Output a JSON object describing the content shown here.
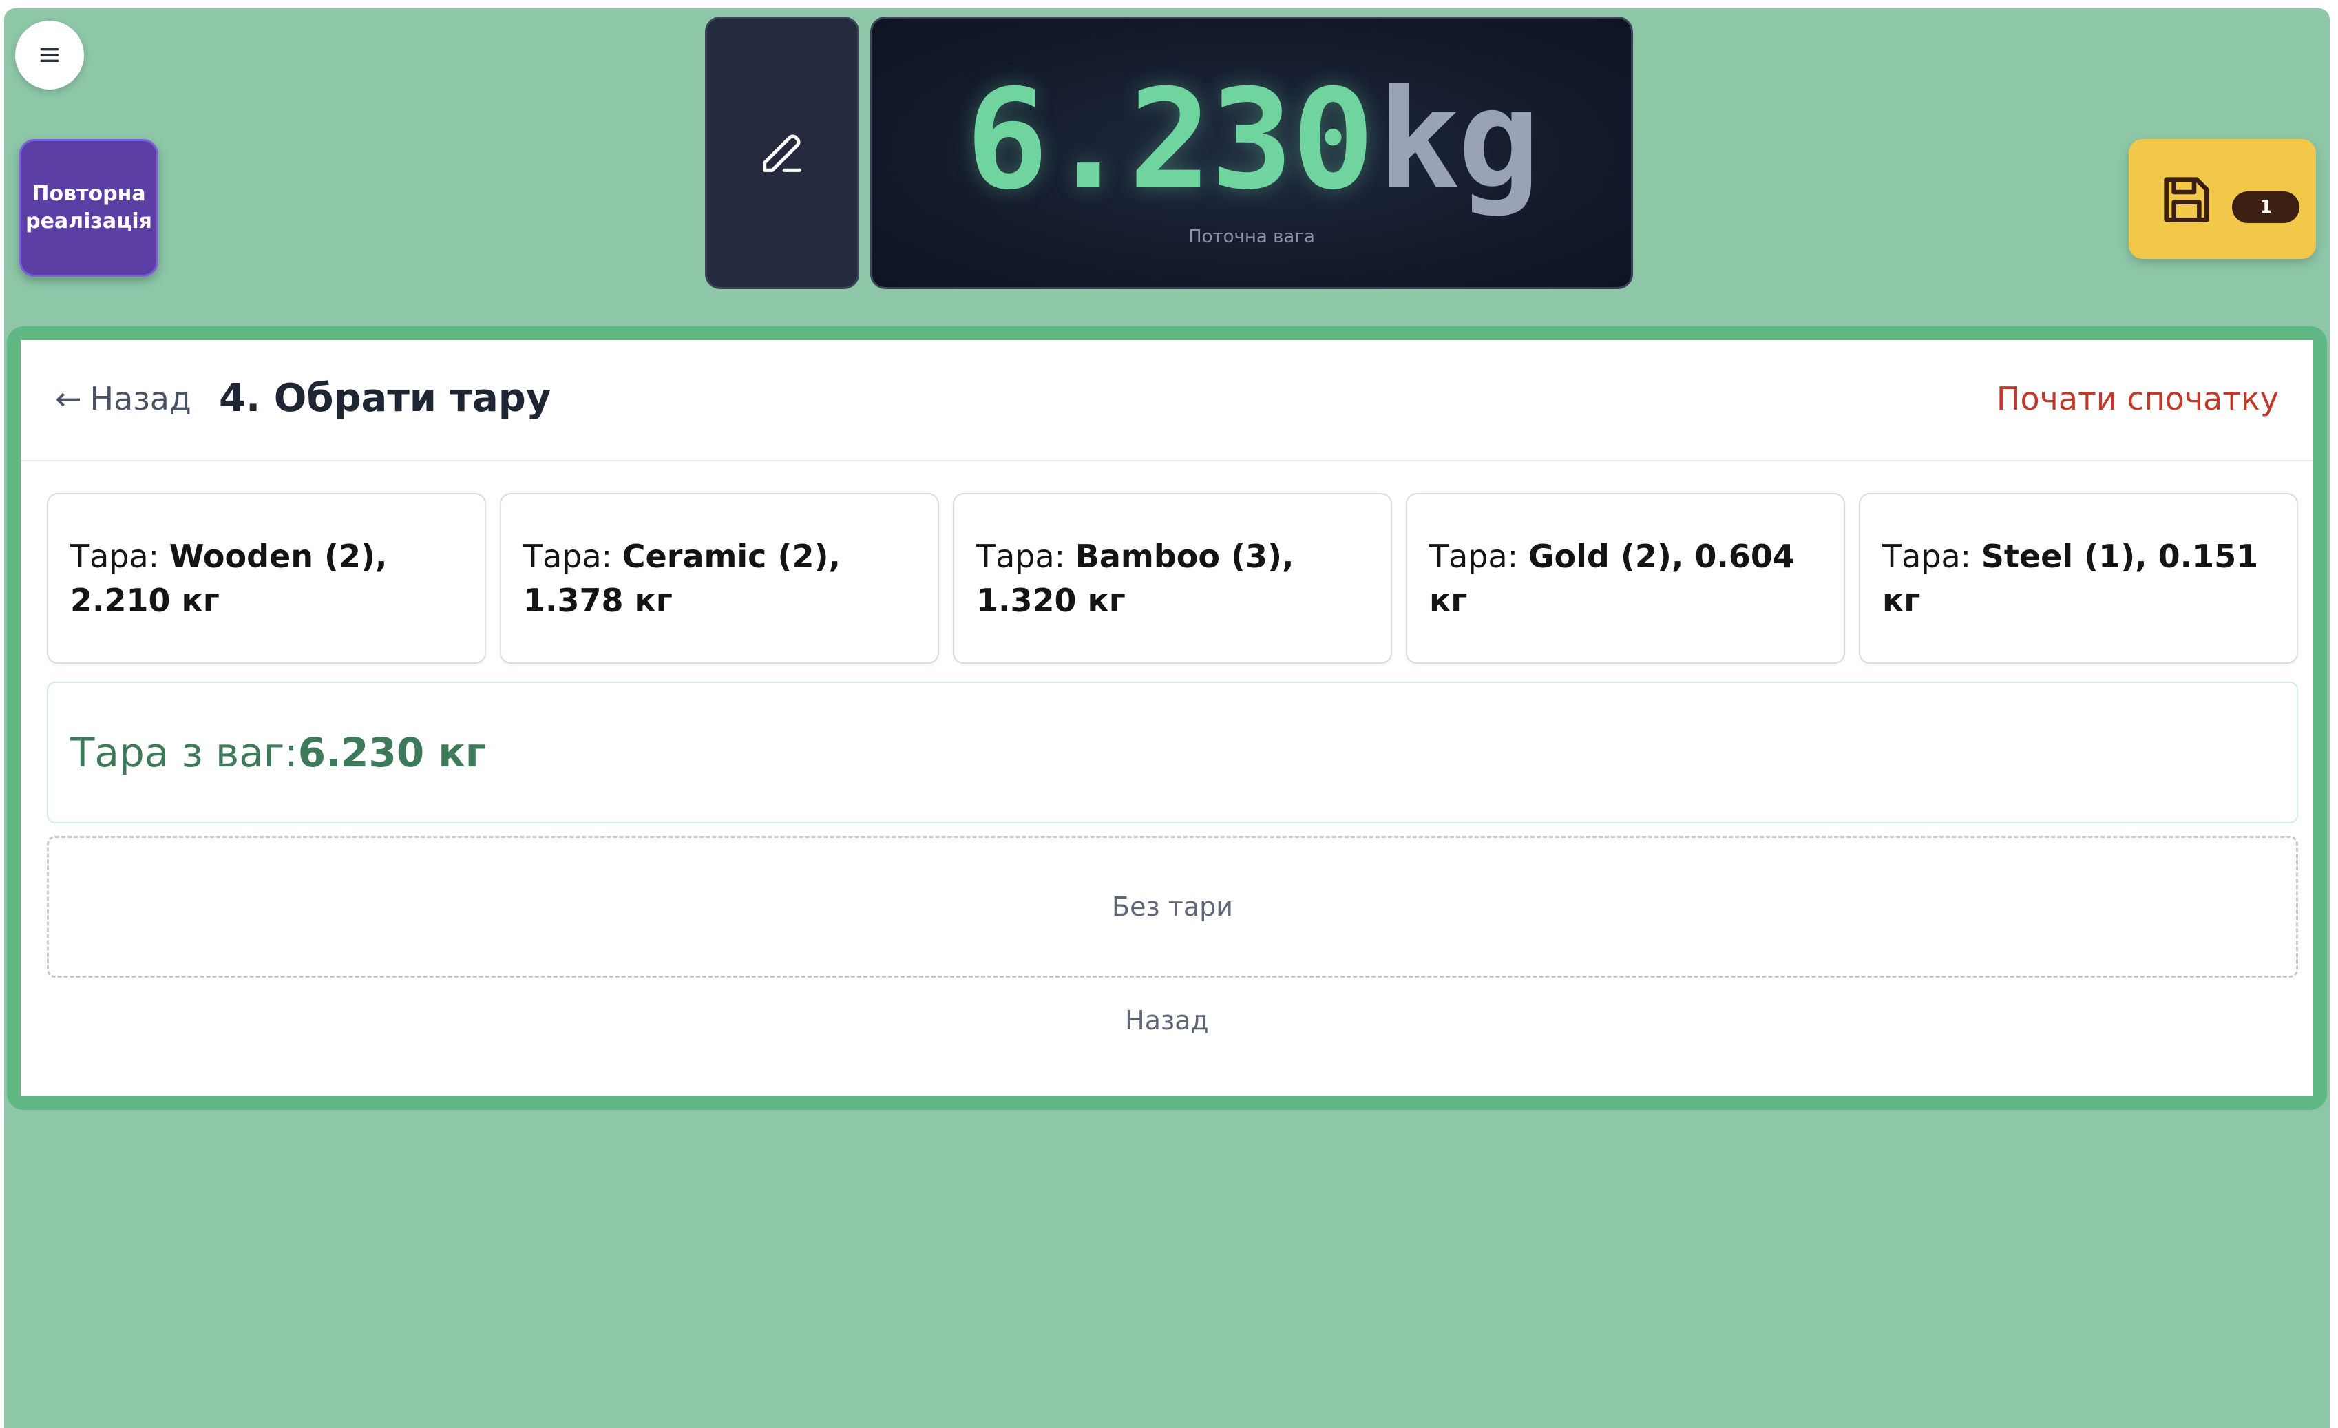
{
  "topbar": {
    "menu_icon": "hamburger-menu-icon",
    "repeat_button_label": "Повторна\nреалізація",
    "edit_icon": "pencil-icon",
    "weight": {
      "value": "6.230",
      "unit": "kg",
      "caption": "Поточна вага"
    },
    "save": {
      "icon": "floppy-disk-icon",
      "badge": "1"
    }
  },
  "card": {
    "back_label": "Назад",
    "title": "4. Обрати тару",
    "restart_label": "Почати спочатку",
    "tare_options": [
      {
        "label": "Тара: ",
        "value": "Wooden (2), 2.210 кг"
      },
      {
        "label": "Тара: ",
        "value": "Ceramic (2), 1.378 кг"
      },
      {
        "label": "Тара: ",
        "value": "Bamboo (3), 1.320 кг"
      },
      {
        "label": "Тара: ",
        "value": "Gold (2), 0.604 кг"
      },
      {
        "label": "Тара: ",
        "value": "Steel (1), 0.151 кг"
      }
    ],
    "scale_tare": {
      "label": "Тара з ваг: ",
      "value": "6.230 кг"
    },
    "no_tare_label": "Без тари",
    "bottom_back_label": "Назад"
  },
  "colors": {
    "background": "#8dc7a8",
    "card_frame": "#5fb884",
    "weight_value": "#6fd49d",
    "repeat_button": "#5b3fa5",
    "save_button": "#f2c84b",
    "restart_link": "#c0392b",
    "scale_tare_text": "#3d7a5a"
  }
}
